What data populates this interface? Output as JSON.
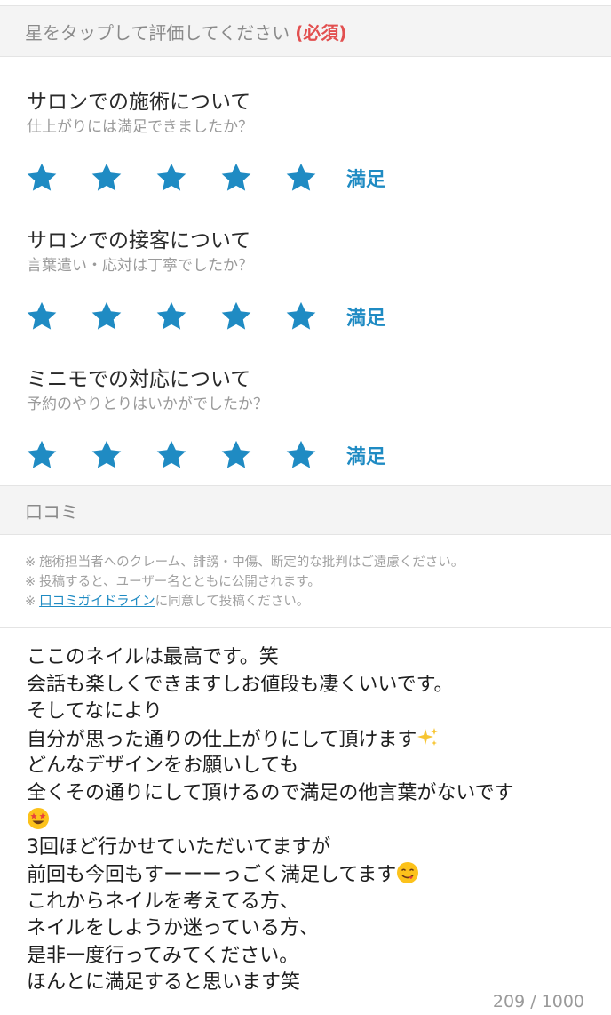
{
  "rating_header": {
    "label": "星をタップして評価してください",
    "required": "(必須)"
  },
  "ratings": [
    {
      "title": "サロンでの施術について",
      "subtitle": "仕上がりには満足できましたか？",
      "stars": 5,
      "max_stars": 5,
      "value_label": "満足"
    },
    {
      "title": "サロンでの接客について",
      "subtitle": "言葉遣い・応対は丁寧でしたか？",
      "stars": 5,
      "max_stars": 5,
      "value_label": "満足"
    },
    {
      "title": "ミニモでの対応について",
      "subtitle": "予約のやりとりはいかがでしたか？",
      "stars": 5,
      "max_stars": 5,
      "value_label": "満足"
    }
  ],
  "review_header": {
    "label": "口コミ"
  },
  "notes": {
    "mark": "※",
    "line1": "施術担当者へのクレーム、誹謗・中傷、断定的な批判はご遠慮ください。",
    "line2": "投稿すると、ユーザー名とともに公開されます。",
    "line3_link": "口コミガイドライン",
    "line3_rest": "に同意して投稿ください。"
  },
  "review": {
    "lines": [
      "ここのネイルは最高です。笑",
      "会話も楽しくできますしお値段も凄くいいです。",
      "そしてなにより",
      "自分が思った通りの仕上がりにして頂けます",
      "どんなデザインをお願いしても",
      "全くその通りにして頂けるので満足の他言葉がないです",
      "",
      "3回ほど行かせていただいてますが",
      "前回も今回もすーーーっごく満足してます",
      "これからネイルを考えてる方、",
      "ネイルをしようか迷っている方、",
      "是非一度行ってみてください。",
      "ほんとに満足すると思います笑"
    ],
    "emojis": {
      "line4": "sparkles-emoji",
      "line7": "star-struck-emoji",
      "line9": "yum-face-emoji"
    }
  },
  "counter": {
    "text": "209 / 1000"
  },
  "colors": {
    "star": "#1f8bc3",
    "value": "#1f8bc3",
    "required": "#e25050",
    "header_bg": "#f4f4f4"
  }
}
